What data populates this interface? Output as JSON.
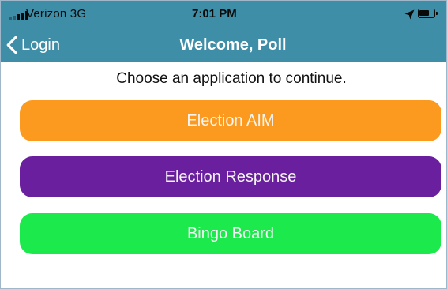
{
  "status_bar": {
    "carrier": "Verizon  3G",
    "time": "7:01 PM",
    "signal_icon": "cellular-signal-icon",
    "location_icon": "location-arrow-icon",
    "battery_icon": "battery-icon",
    "battery_level": 0.7
  },
  "nav": {
    "back_label": "Login",
    "back_icon": "chevron-left-icon",
    "title": "Welcome, Poll",
    "background": "#3f8ea8"
  },
  "main": {
    "prompt": "Choose an application to continue.",
    "apps": [
      {
        "label": "Election AIM",
        "color": "#fb9a1e"
      },
      {
        "label": "Election Response",
        "color": "#6a1f9e"
      },
      {
        "label": "Bingo Board",
        "color": "#1ce94b"
      }
    ]
  }
}
